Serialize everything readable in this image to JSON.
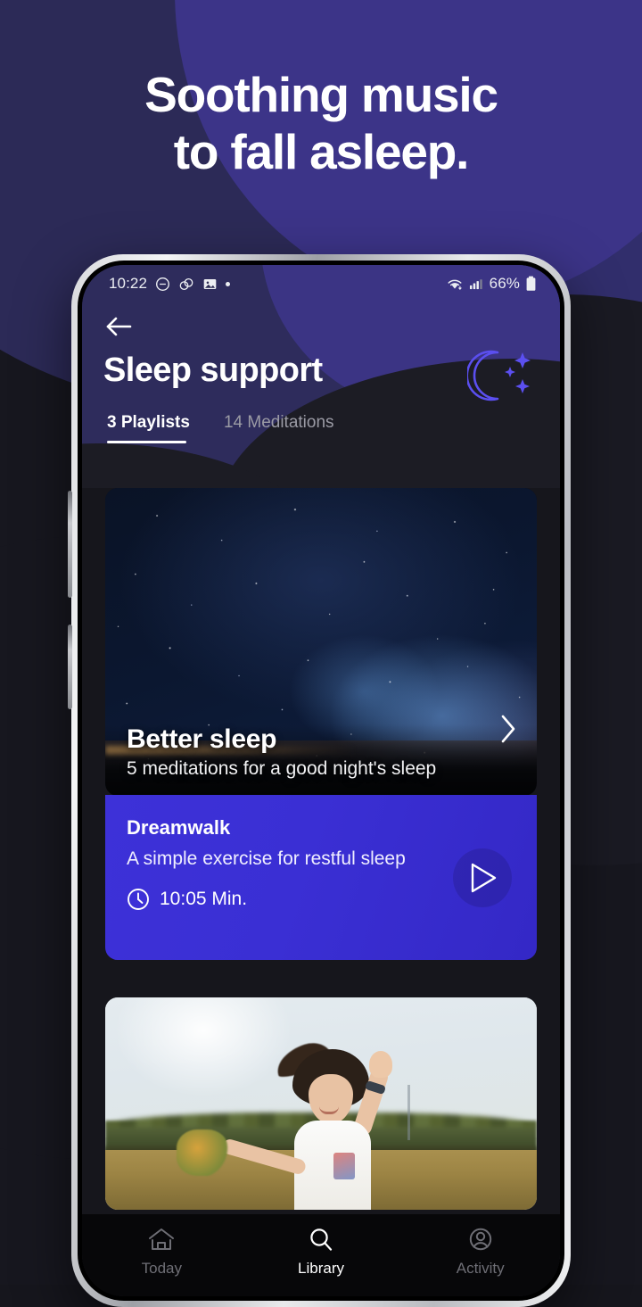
{
  "promo": {
    "headline_line1": "Soothing music",
    "headline_line2": "to fall asleep.",
    "bg_color": "#17171f",
    "accent_color": "#3b3484"
  },
  "status_bar": {
    "time": "10:22",
    "dnd_icon": "do-not-disturb-icon",
    "link_icon": "link-icon",
    "image_icon": "image-icon",
    "dot_icon": "dot-icon",
    "wifi_icon": "wifi-icon",
    "signal_icon": "cellular-signal-icon",
    "battery_percent": "66%",
    "battery_icon": "battery-icon"
  },
  "header": {
    "back_icon": "back-arrow-icon",
    "title": "Sleep support",
    "decor_icon": "moon-and-stars-icon",
    "accent_color": "#5b4ff0"
  },
  "tabs": [
    {
      "label": "3 Playlists",
      "active": true
    },
    {
      "label": "14 Meditations",
      "active": false
    }
  ],
  "playlist_card": {
    "title": "Better sleep",
    "subtitle": "5 meditations for a good night's sleep",
    "chevron_icon": "chevron-right-icon",
    "image_alt": "night-sky-milky-way-photo"
  },
  "meditation_card": {
    "title": "Dreamwalk",
    "subtitle": "A simple exercise for restful sleep",
    "duration": "10:05 Min.",
    "clock_icon": "clock-icon",
    "play_icon": "play-icon",
    "bg_color": "#3a2fd4"
  },
  "photo_card": {
    "image_alt": "woman-dancing-in-field-photo"
  },
  "bottom_nav": [
    {
      "label": "Today",
      "icon": "home-icon",
      "active": false
    },
    {
      "label": "Library",
      "icon": "search-icon",
      "active": true
    },
    {
      "label": "Activity",
      "icon": "person-icon",
      "active": false
    }
  ]
}
